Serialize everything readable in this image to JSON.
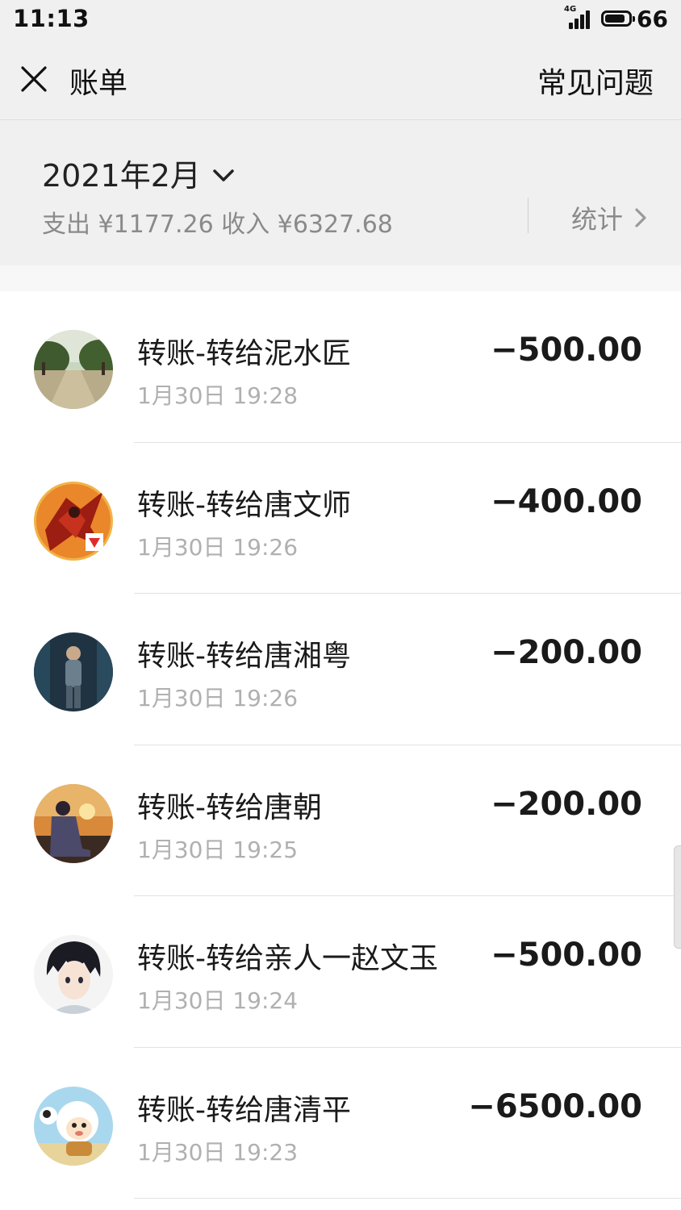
{
  "status_bar": {
    "time": "11:13",
    "network": "4G",
    "battery": "66"
  },
  "nav": {
    "title": "账单",
    "faq_label": "常见问题",
    "close_icon": "close-icon"
  },
  "summary": {
    "month": "2021年2月",
    "totals": "支出 ¥1177.26 收入 ¥6327.68",
    "stats_label": "统计"
  },
  "transactions": [
    {
      "title": "转账-转给泥水匠",
      "time": "1月30日 19:28",
      "amount": "−500.00",
      "avatar": "avatar-park-path"
    },
    {
      "title": "转账-转给唐文师",
      "time": "1月30日 19:26",
      "amount": "−400.00",
      "avatar": "avatar-red-warrior"
    },
    {
      "title": "转账-转给唐湘粤",
      "time": "1月30日 19:26",
      "amount": "−200.00",
      "avatar": "avatar-dark-figure"
    },
    {
      "title": "转账-转给唐朝",
      "time": "1月30日 19:25",
      "amount": "−200.00",
      "avatar": "avatar-sunset-sitting"
    },
    {
      "title": "转账-转给亲人一赵文玉",
      "time": "1月30日 19:24",
      "amount": "−500.00",
      "avatar": "avatar-anime-boy"
    },
    {
      "title": "转账-转给唐清平",
      "time": "1月30日 19:23",
      "amount": "−6500.00",
      "avatar": "avatar-cartoon-sheep"
    }
  ],
  "colors": {
    "header_bg": "#f0f0f0",
    "list_bg": "#ffffff",
    "secondary_text": "#8a8a8a",
    "time_text": "#b0b0b0"
  }
}
